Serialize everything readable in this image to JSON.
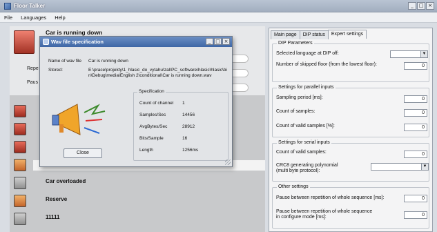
{
  "window": {
    "title": "Floor Talker",
    "controls": [
      "_",
      "□",
      "×"
    ]
  },
  "menu": [
    "File",
    "Languages",
    "Help"
  ],
  "left": {
    "running_title": "Car is running down",
    "side_labels": [
      "Repe",
      "Paus"
    ],
    "rows": [
      {
        "label": "",
        "icon": "elevator-icon"
      },
      {
        "label": "",
        "icon": "arrows-icon"
      },
      {
        "label": "",
        "icon": "door-icon"
      },
      {
        "label": "",
        "icon": "elevator-icon"
      },
      {
        "label": "Car overloaded",
        "icon": "overload-icon"
      },
      {
        "label": "Reserve",
        "icon": "reserve-icon"
      },
      {
        "label": "11111",
        "icon": "elevator-icon"
      }
    ]
  },
  "dialog": {
    "title": "Wav file specification",
    "wav_name_label": "Name of wav file",
    "wav_name_value": "Car is running down",
    "stored_label": "Stored:",
    "stored_value": "E:\\prace\\projekty\\1_hlasic_do_vytahu\\zal\\PC_software\\hlasic\\hlasic\\bin\\Debug\\media\\English 2\\conditional\\Car is running down.wav",
    "spec_title": "Specification",
    "spec": [
      {
        "k": "Count of channel",
        "v": "1"
      },
      {
        "k": "Samples/Sec",
        "v": "14456"
      },
      {
        "k": "AvgBytes/Sec",
        "v": "28912"
      },
      {
        "k": "Bits/Sample",
        "v": "16"
      },
      {
        "k": "Length",
        "v": "1256ms"
      }
    ],
    "close_label": "Close"
  },
  "right": {
    "tabs": [
      "Main page",
      "DIP status",
      "Expert settings"
    ],
    "active_tab": 2,
    "dip": {
      "title": "DIP Parameters",
      "lang_label": "Selected language at DIP off:",
      "skipped_label": "Number of skipped floor (from the lowest floor):",
      "skipped_value": "0"
    },
    "parallel": {
      "title": "Settings for parallel inputs",
      "period_label": "Sampling period [ms]:",
      "period_value": "0",
      "count_label": "Count of samples:",
      "count_value": "0",
      "valid_label": "Count of valid samples [%]:",
      "valid_value": "0"
    },
    "serial": {
      "title": "Settings for serial inputs",
      "valid_label": "Count of valid samples:",
      "valid_value": "0",
      "crc_label": "CRC8 generating polynomial",
      "crc_sub": "(multi byte protocol):"
    },
    "other": {
      "title": "Other settings",
      "pause_label": "Pause between repetition of whole sequence [ms]:",
      "pause_value": "0",
      "pause_cfg_label": "Pause between repetition of whole sequence",
      "pause_cfg_sub": "in configure mode [ms]:",
      "pause_cfg_value": "0"
    }
  },
  "colors": {
    "accent": "#3e67a6",
    "elevator_red": "#c44434"
  }
}
